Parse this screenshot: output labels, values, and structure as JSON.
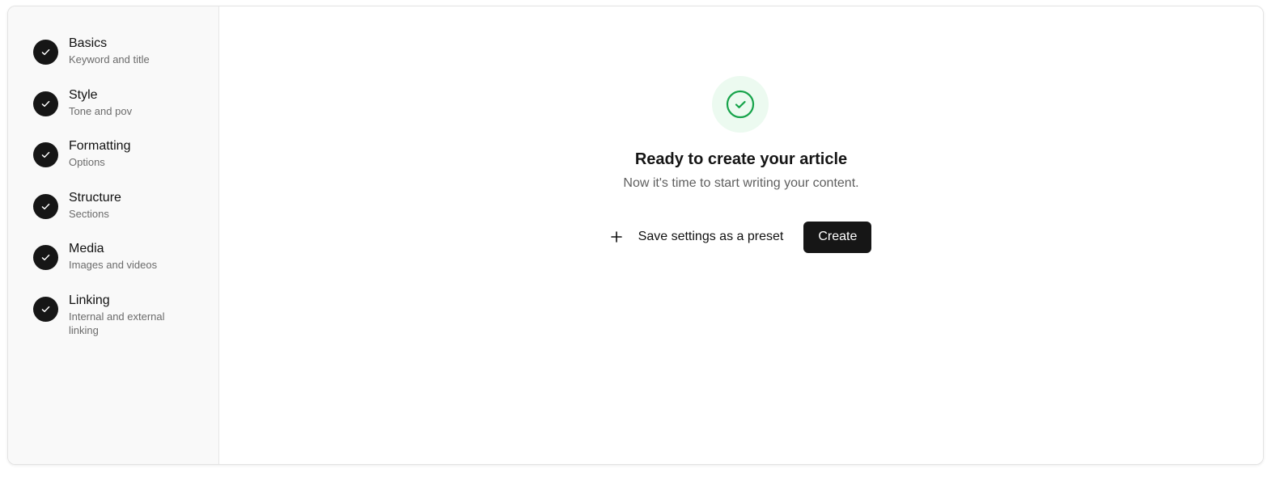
{
  "sidebar": {
    "steps": [
      {
        "title": "Basics",
        "subtitle": "Keyword and title",
        "icon": "check-icon",
        "status": "complete"
      },
      {
        "title": "Style",
        "subtitle": "Tone and pov",
        "icon": "check-icon",
        "status": "complete"
      },
      {
        "title": "Formatting",
        "subtitle": "Options",
        "icon": "check-icon",
        "status": "complete"
      },
      {
        "title": "Structure",
        "subtitle": "Sections",
        "icon": "check-icon",
        "status": "complete"
      },
      {
        "title": "Media",
        "subtitle": "Images and videos",
        "icon": "check-icon",
        "status": "complete"
      },
      {
        "title": "Linking",
        "subtitle": "Internal and external linking",
        "icon": "check-icon",
        "status": "complete"
      }
    ]
  },
  "main": {
    "icon": "check-circle-icon",
    "title": "Ready to create your article",
    "subtitle": "Now it's time to start writing your content.",
    "preset_label": "Save settings as a preset",
    "preset_icon": "plus-icon",
    "create_label": "Create"
  },
  "colors": {
    "primary": "#161616",
    "success": "#16a34a",
    "success_bg": "#ecfaf0",
    "sidebar_bg": "#f9f9f9",
    "muted_text": "#6b6b6b"
  }
}
